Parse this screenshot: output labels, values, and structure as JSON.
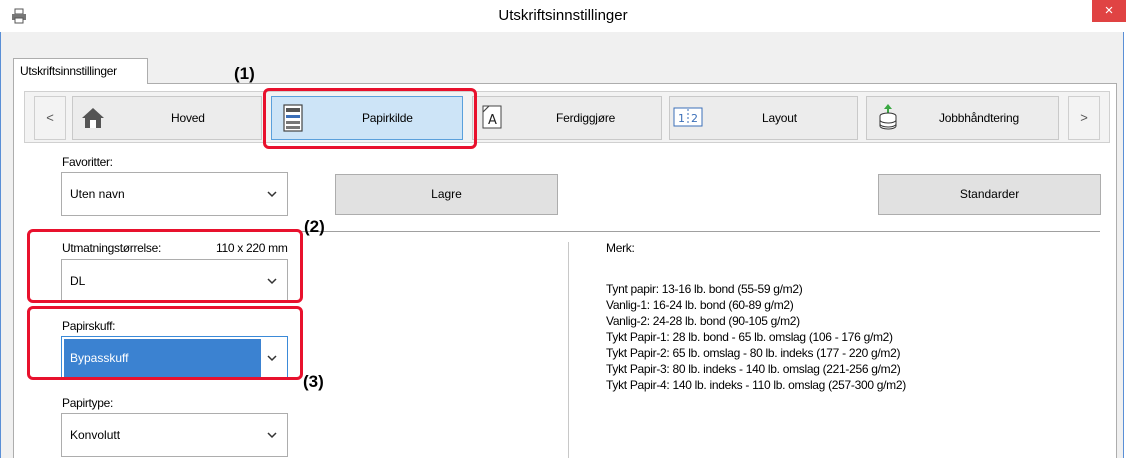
{
  "window": {
    "title": "Utskriftsinnstillinger",
    "close_label": "×"
  },
  "tabs": [
    {
      "label": "Utskriftsinnstillinger"
    }
  ],
  "nav": {
    "prev": "<",
    "next": ">",
    "items": [
      {
        "label": "Hoved",
        "icon": "home-icon"
      },
      {
        "label": "Papirkilde",
        "icon": "printer-tray-icon"
      },
      {
        "label": "Ferdiggjøre",
        "icon": "finishing-icon"
      },
      {
        "label": "Layout",
        "icon": "layout-icon"
      },
      {
        "label": "Jobbhåndtering",
        "icon": "job-storage-icon"
      }
    ],
    "active": "Papirkilde"
  },
  "favorites": {
    "label": "Favoritter:",
    "value": "Uten navn",
    "save_label": "Lagre",
    "defaults_label": "Standarder"
  },
  "output_size": {
    "label": "Utmatningstørrelse:",
    "dimension": "110 x 220 mm",
    "value": "DL"
  },
  "paper_tray": {
    "label": "Papirskuff:",
    "value": "Bypasskuff"
  },
  "paper_type": {
    "label": "Papirtype:",
    "value": "Konvolutt"
  },
  "note": {
    "heading": "Merk:",
    "lines": [
      "Tynt papir: 13-16 lb. bond (55-59 g/m2)",
      "Vanlig-1: 16-24 lb. bond (60-89 g/m2)",
      "Vanlig-2: 24-28 lb. bond (90-105 g/m2)",
      "Tykt Papir-1: 28 lb. bond - 65 lb. omslag (106 - 176 g/m2)",
      "Tykt Papir-2: 65 lb. omslag - 80 lb. indeks (177 - 220 g/m2)",
      "Tykt Papir-3: 80 lb. indeks - 140 lb. omslag (221-256 g/m2)",
      "Tykt Papir-4: 140 lb. indeks - 110 lb. omslag (257-300 g/m2)"
    ]
  },
  "callouts": {
    "c1": "(1)",
    "c2": "(2)",
    "c3": "(3)"
  },
  "colors": {
    "callout": "#e8112d",
    "active_nav": "#cde4f7",
    "selection": "#3b82d1",
    "close_button": "#e04343"
  }
}
